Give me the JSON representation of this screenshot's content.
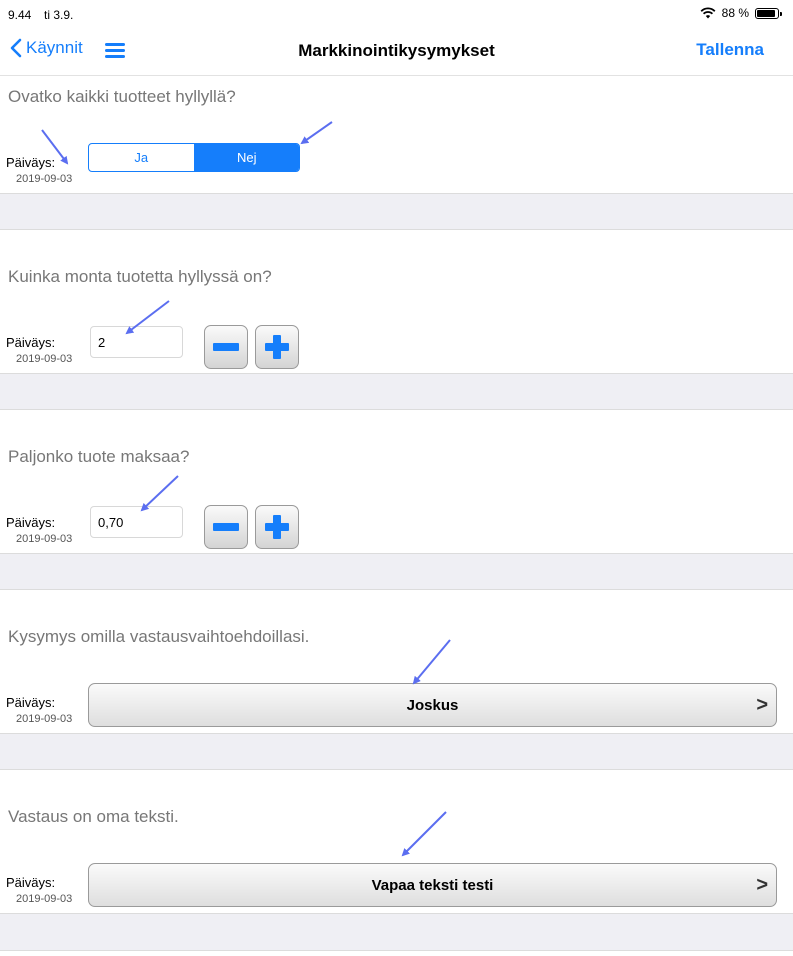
{
  "status_bar": {
    "time": "9.44",
    "date": "ti 3.9.",
    "battery": "88 %"
  },
  "nav": {
    "back_label": "Käynnit",
    "title": "Markkinointikysymykset",
    "save_label": "Tallenna"
  },
  "questions": [
    {
      "question": "Ovatko kaikki tuotteet hyllyllä?",
      "date_label": "Päiväys:",
      "date": "2019-09-03",
      "options": [
        "Ja",
        "Nej"
      ],
      "selected": "Nej"
    },
    {
      "question": "Kuinka monta tuotetta hyllyssä on?",
      "date_label": "Päiväys:",
      "date": "2019-09-03",
      "value": "2"
    },
    {
      "question": "Paljonko tuote maksaa?",
      "date_label": "Päiväys:",
      "date": "2019-09-03",
      "value": "0,70"
    },
    {
      "question": "Kysymys omilla vastausvaihtoehdoillasi.",
      "date_label": "Päiväys:",
      "date": "2019-09-03",
      "answer": "Joskus",
      "chevron": ">"
    },
    {
      "question": "Vastaus on oma teksti.",
      "date_label": "Päiväys:",
      "date": "2019-09-03",
      "answer": "Vapaa teksti testi",
      "chevron": ">"
    }
  ],
  "colors": {
    "accent": "#157efb",
    "annotation_arrow": "#5b6ef0",
    "separator": "#efeff4"
  },
  "icons": {
    "back": "chevron-left-icon",
    "menu": "hamburger-icon",
    "minus": "minus-icon",
    "plus": "plus-icon",
    "wifi": "wifi-icon",
    "battery": "battery-icon"
  }
}
